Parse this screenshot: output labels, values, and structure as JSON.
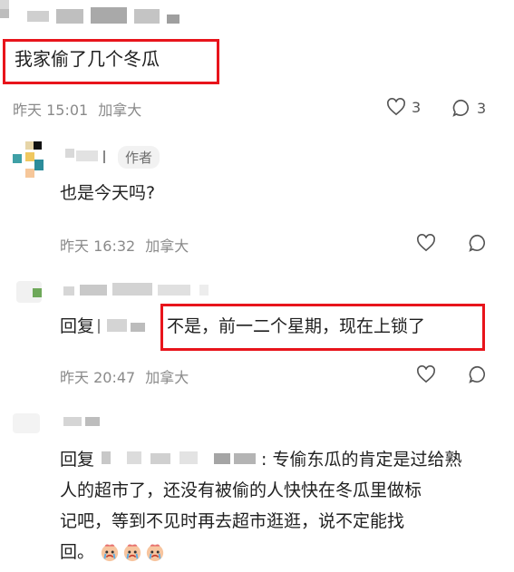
{
  "post": {
    "text": "我家偷了几个冬瓜",
    "time": "昨天 15:01",
    "location": "加拿大",
    "likes": "3",
    "comments": "3"
  },
  "reply1": {
    "author_badge": "作者",
    "text": "也是今天吗?",
    "time": "昨天 16:32",
    "location": "加拿大"
  },
  "reply2": {
    "prefix": "回复",
    "text": "不是，前一二个星期，现在上锁了",
    "time": "昨天 20:47",
    "location": "加拿大"
  },
  "reply3": {
    "prefix": "回复",
    "line1": ": 专偷东瓜的肯定是过给熟",
    "line2": "人的超市了，还没有被偷的人快快在冬瓜里做标",
    "line3": "记吧，等到不见时再去超市逛逛，说不定能找",
    "line4": "回。"
  },
  "icons": [
    "heart-icon",
    "comment-icon",
    "crying-emoji-icon"
  ],
  "colors": {
    "highlight": "#e8141b",
    "meta": "#8a8a8a"
  }
}
